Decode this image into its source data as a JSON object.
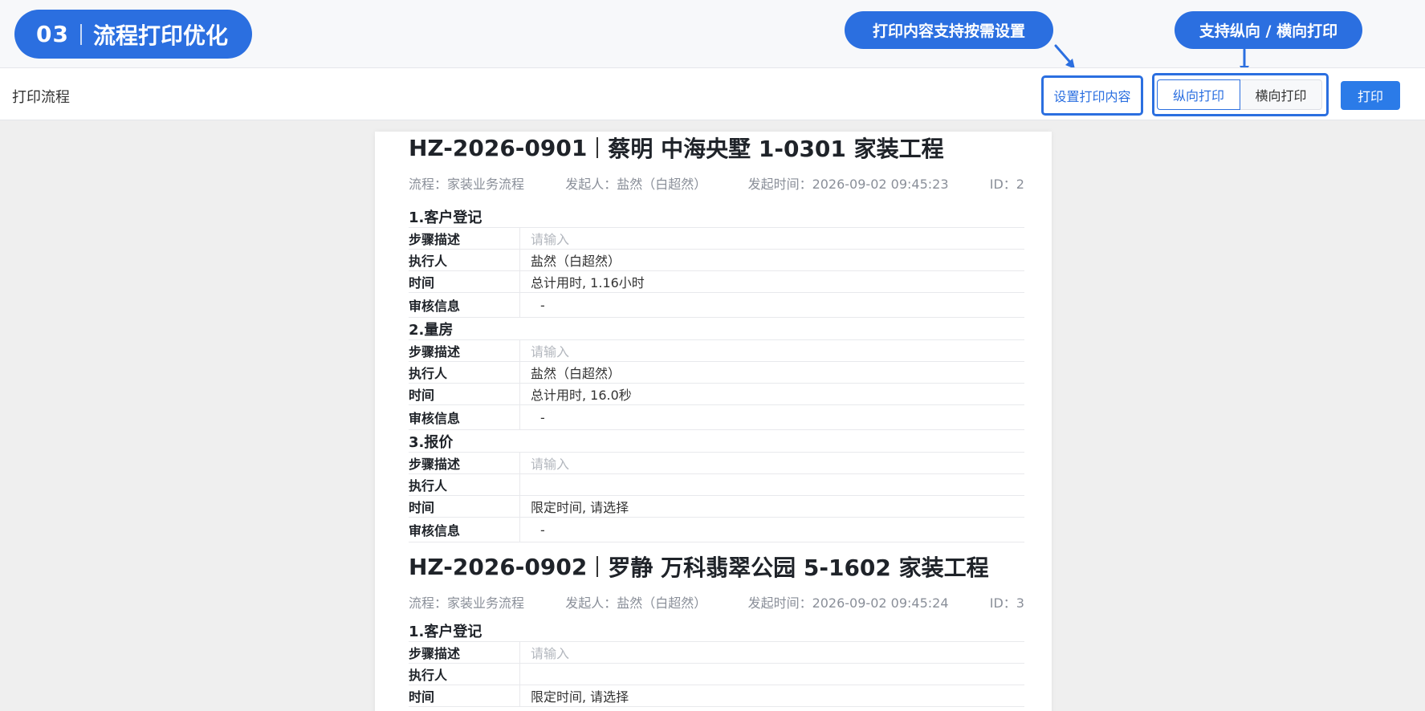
{
  "badge": {
    "number": "03",
    "title": "流程打印优化"
  },
  "callouts": {
    "content": "打印内容支持按需设置",
    "orientation": "支持纵向 / 横向打印"
  },
  "toolbar": {
    "title": "打印流程",
    "set_content": "设置打印内容",
    "portrait": "纵向打印",
    "landscape": "横向打印",
    "print": "打印"
  },
  "records": [
    {
      "code": "HZ-2026-0901",
      "name": "蔡明 中海央墅 1-0301 家装工程",
      "flow": "流程：家装业务流程",
      "initiator": "发起人：盐然（白超然）",
      "time": "发起时间：2026-09-02 09:45:23",
      "id": "ID：2",
      "sections": [
        {
          "title": "1.客户登记",
          "rows": [
            {
              "label": "步骤描述",
              "value": "请输入"
            },
            {
              "label": "执行人",
              "value": "盐然（白超然）"
            },
            {
              "label": "时间",
              "value": "总计用时, 1.16小时"
            },
            {
              "label": "审核信息",
              "value": "-"
            }
          ]
        },
        {
          "title": "2.量房",
          "rows": [
            {
              "label": "步骤描述",
              "value": "请输入"
            },
            {
              "label": "执行人",
              "value": "盐然（白超然）"
            },
            {
              "label": "时间",
              "value": "总计用时, 16.0秒"
            },
            {
              "label": "审核信息",
              "value": "-"
            }
          ]
        },
        {
          "title": "3.报价",
          "rows": [
            {
              "label": "步骤描述",
              "value": "请输入"
            },
            {
              "label": "执行人",
              "value": ""
            },
            {
              "label": "时间",
              "value": "限定时间, 请选择"
            },
            {
              "label": "审核信息",
              "value": "-"
            }
          ]
        }
      ]
    },
    {
      "code": "HZ-2026-0902",
      "name": "罗静 万科翡翠公园 5-1602 家装工程",
      "flow": "流程：家装业务流程",
      "initiator": "发起人：盐然（白超然）",
      "time": "发起时间：2026-09-02 09:45:24",
      "id": "ID：3",
      "sections": [
        {
          "title": "1.客户登记",
          "rows": [
            {
              "label": "步骤描述",
              "value": "请输入"
            },
            {
              "label": "执行人",
              "value": ""
            },
            {
              "label": "时间",
              "value": "限定时间, 请选择"
            }
          ]
        }
      ]
    }
  ],
  "colors": {
    "accent": "#2b6fe0",
    "print_button": "#2b7be8",
    "placeholder": "#b3b7be"
  }
}
